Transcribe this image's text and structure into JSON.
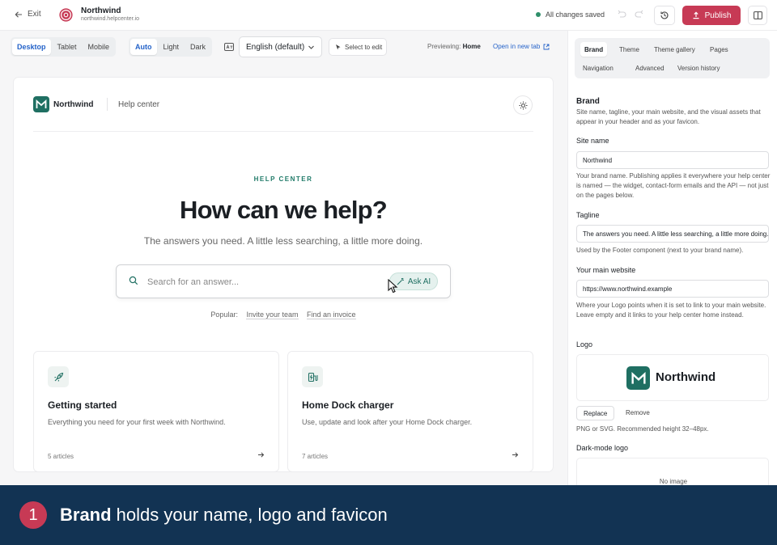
{
  "topbar": {
    "exit_label": "Exit",
    "site_name": "Northwind",
    "site_url": "northwind.helpcenter.io",
    "save_status": "All changes saved",
    "publish_label": "Publish"
  },
  "toolbar": {
    "device_options": [
      "Desktop",
      "Tablet",
      "Mobile"
    ],
    "device_active": "Desktop",
    "theme_options": [
      "Auto",
      "Light",
      "Dark"
    ],
    "theme_active": "Auto",
    "language": "English (default)",
    "select_to_edit": "Select to edit",
    "previewing_label": "Previewing:",
    "previewing_page": "Home",
    "open_new_tab": "Open in new tab"
  },
  "preview": {
    "brand": "Northwind",
    "help_center_link": "Help center",
    "eyebrow": "HELP CENTER",
    "title": "How can we help?",
    "subtitle": "The answers you need. A little less searching, a little more doing.",
    "search_placeholder": "Search for an answer...",
    "ask_ai": "Ask AI",
    "popular_label": "Popular:",
    "popular_links": [
      "Invite your team",
      "Find an invoice"
    ],
    "cards": [
      {
        "icon": "rocket-icon",
        "title": "Getting started",
        "description": "Everything you need for your first week with Northwind.",
        "count": "5 articles"
      },
      {
        "icon": "ev-charger-icon",
        "title": "Home Dock charger",
        "description": "Use, update and look after your Home Dock charger.",
        "count": "7 articles"
      }
    ]
  },
  "panel": {
    "tabs": [
      "Brand",
      "Theme",
      "Theme gallery",
      "Pages",
      "Navigation",
      "Advanced",
      "Version history"
    ],
    "active_tab": "Brand",
    "section_title": "Brand",
    "section_desc": "Site name, tagline, your main website, and the visual assets that appear in your header and as your favicon.",
    "site_name_label": "Site name",
    "site_name_value": "Northwind",
    "site_name_help": "Your brand name. Publishing applies it everywhere your help center is named — the widget, contact-form emails and the API — not just on the pages below.",
    "tagline_label": "Tagline",
    "tagline_value": "The answers you need. A little less searching, a little more doing.",
    "tagline_help": "Used by the Footer component (next to your brand name).",
    "website_label": "Your main website",
    "website_value": "https://www.northwind.example",
    "website_help": "Where your Logo points when it is set to link to your main website. Leave empty and it links to your help center home instead.",
    "logo_label": "Logo",
    "logo_name": "Northwind",
    "replace_label": "Replace",
    "remove_label": "Remove",
    "logo_help": "PNG or SVG. Recommended height 32–48px.",
    "dark_logo_label": "Dark-mode logo",
    "dark_logo_empty": "No image"
  },
  "caption": {
    "step": "1",
    "bold": "Brand",
    "rest": " holds your name, logo and favicon"
  },
  "colors": {
    "accent": "#c73a55",
    "brand": "#1f6f62",
    "link": "#2563c9",
    "caption_bg": "#123353"
  }
}
